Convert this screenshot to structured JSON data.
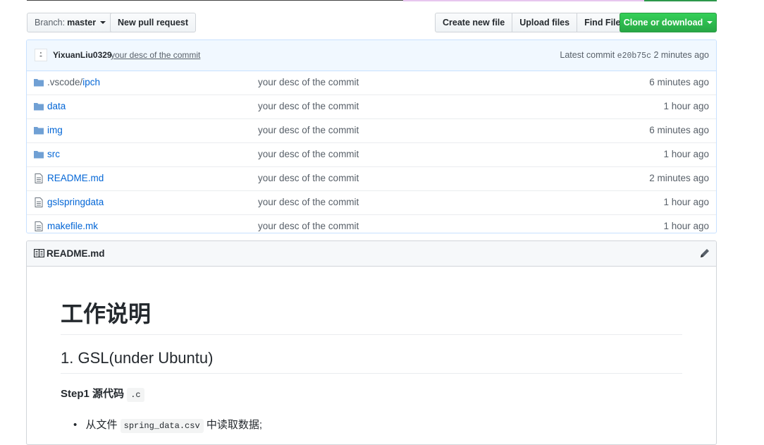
{
  "toolbar": {
    "branch_prefix": "Branch:",
    "branch_name": "master",
    "new_pull_request": "New pull request",
    "create_new_file": "Create new file",
    "upload_files": "Upload files",
    "find_file": "Find File",
    "clone_or_download": "Clone or download"
  },
  "commit": {
    "avatar_glyph": "⍘",
    "author": "YixuanLiu0329",
    "message": "your desc of the commit",
    "latest_label": "Latest commit",
    "sha": "e20b75c",
    "age": "2 minutes ago"
  },
  "files": [
    {
      "type": "folder",
      "prefix": ".vscode/",
      "name": "ipch",
      "message": "your desc of the commit",
      "age": "6 minutes ago"
    },
    {
      "type": "folder",
      "prefix": "",
      "name": "data",
      "message": "your desc of the commit",
      "age": "1 hour ago"
    },
    {
      "type": "folder",
      "prefix": "",
      "name": "img",
      "message": "your desc of the commit",
      "age": "6 minutes ago"
    },
    {
      "type": "folder",
      "prefix": "",
      "name": "src",
      "message": "your desc of the commit",
      "age": "1 hour ago"
    },
    {
      "type": "file",
      "prefix": "",
      "name": "README.md",
      "message": "your desc of the commit",
      "age": "2 minutes ago"
    },
    {
      "type": "file",
      "prefix": "",
      "name": "gslspringdata",
      "message": "your desc of the commit",
      "age": "1 hour ago"
    },
    {
      "type": "file",
      "prefix": "",
      "name": "makefile.mk",
      "message": "your desc of the commit",
      "age": "1 hour ago"
    }
  ],
  "readme": {
    "title": "README.md",
    "h1": "工作说明",
    "h2": "1. GSL(under Ubuntu)",
    "h3_text": "Step1 源代码",
    "h3_code": ".c",
    "li_prefix": "从文件",
    "li_code": "spring_data.csv",
    "li_suffix": "中读取数据;"
  },
  "colors": {
    "link": "#0366d6",
    "clone_button": "#28a745",
    "commit_bar": "#f1f8ff",
    "folder_icon": "#79b8ff"
  }
}
